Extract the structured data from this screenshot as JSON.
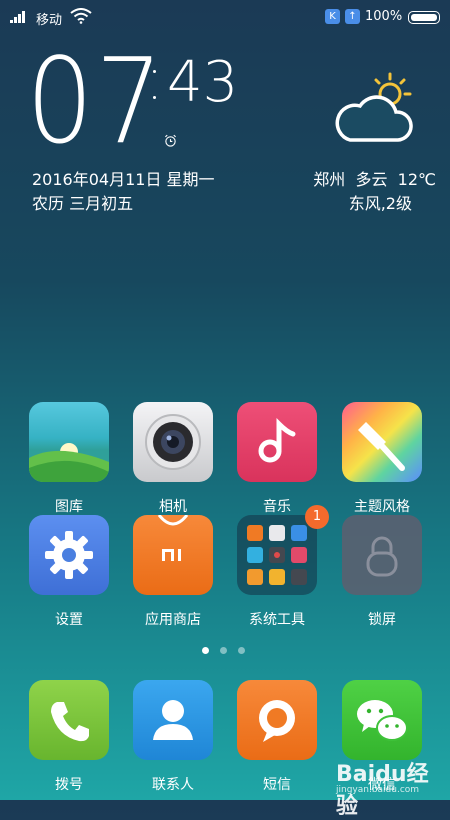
{
  "status_bar": {
    "carrier": "移动",
    "battery": "100%",
    "icons": [
      "signal-icon",
      "wifi-icon",
      "k-app-icon",
      "upload-icon",
      "battery-icon"
    ]
  },
  "clock": {
    "hours": "07",
    "minutes": "43",
    "date": "2016年04月11日 星期一",
    "lunar": "农历 三月初五"
  },
  "weather": {
    "city": "郑州",
    "condition": "多云",
    "temp": "12℃",
    "wind": "东风,2级"
  },
  "apps_row1": [
    {
      "label": "图库",
      "icon": "gallery-icon"
    },
    {
      "label": "相机",
      "icon": "camera-icon"
    },
    {
      "label": "音乐",
      "icon": "music-icon"
    },
    {
      "label": "主题风格",
      "icon": "theme-icon"
    }
  ],
  "apps_row2": [
    {
      "label": "设置",
      "icon": "settings-icon"
    },
    {
      "label": "应用商店",
      "icon": "app-store-icon"
    },
    {
      "label": "系统工具",
      "icon": "folder-icon",
      "badge": "1"
    },
    {
      "label": "锁屏",
      "icon": "lock-icon"
    }
  ],
  "dock": [
    {
      "label": "拨号",
      "icon": "phone-icon"
    },
    {
      "label": "联系人",
      "icon": "contacts-icon"
    },
    {
      "label": "短信",
      "icon": "messages-icon"
    },
    {
      "label": "微信",
      "icon": "wechat-icon"
    }
  ],
  "pages": {
    "count": 3,
    "active": 1
  },
  "watermark": {
    "brand": "Baidu经验",
    "url": "jingyan.baidu.com"
  },
  "colors": {
    "gallery": "#3fb7c6",
    "camera": "#dcdde0",
    "music": "#e8416b",
    "settings": "#4a7fe0",
    "app_store": "#f07a24",
    "lock": "#5b6070",
    "phone": "#7cc63e",
    "contacts": "#2f9ae6",
    "messages": "#f07a24",
    "wechat": "#3fc23a",
    "badge": "#f46a2c"
  }
}
